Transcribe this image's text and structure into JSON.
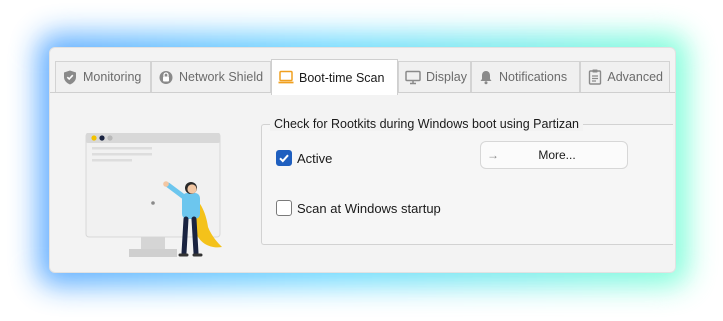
{
  "tabs": [
    {
      "label": "Monitoring",
      "icon": "shield-icon",
      "active": false
    },
    {
      "label": "Network Shield",
      "icon": "lock-icon",
      "active": false
    },
    {
      "label": "Boot-time Scan",
      "icon": "laptop-icon",
      "active": true
    },
    {
      "label": "Display",
      "icon": "monitor-icon",
      "active": false
    },
    {
      "label": "Notifications",
      "icon": "bell-icon",
      "active": false
    },
    {
      "label": "Advanced",
      "icon": "clipboard-icon",
      "active": false
    }
  ],
  "group": {
    "title": "Check for Rootkits during Windows boot using Partizan",
    "active_label": "Active",
    "active_checked": true,
    "startup_label": "Scan at Windows startup",
    "startup_checked": false,
    "more_button": "More...",
    "more_icon": "arrow-right-icon"
  },
  "colors": {
    "accent": "#1f5fbf",
    "active_tab_icon": "#f0a020",
    "glow_left": "#5aa8ff",
    "glow_right": "#7fffd8"
  }
}
